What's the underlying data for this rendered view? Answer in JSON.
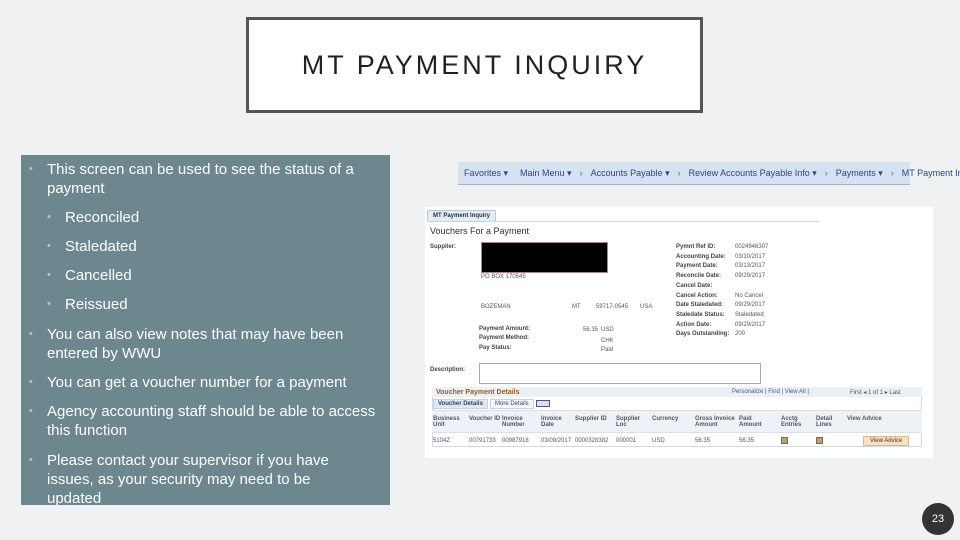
{
  "slide": {
    "title": "MT PAYMENT INQUIRY",
    "page_number": "23"
  },
  "bullets": [
    {
      "text": "This screen can be used to see the status of a payment",
      "sub": [
        "Reconciled",
        "Staledated",
        "Cancelled",
        "Reissued"
      ]
    },
    {
      "text": "You can also view notes that may have been entered by WWU"
    },
    {
      "text": "You can get a voucher number for a payment"
    },
    {
      "text": "Agency accounting staff should be able to access this function"
    },
    {
      "text": "Please contact your supervisor if you have issues, as your security may need to be updated"
    }
  ],
  "nav": {
    "items": [
      "Favorites ▾",
      "Main Menu ▾",
      "Accounts Payable ▾",
      "Review Accounts Payable Info ▾",
      "Payments ▾",
      "MT Payment Inquiry"
    ],
    "sep": "›"
  },
  "ps": {
    "tab": "MT Payment Inquiry",
    "heading": "Vouchers For a Payment",
    "supplier_label": "Supplier:",
    "address": "PO BOX 170545",
    "city": "BOZEMAN",
    "state": "MT",
    "zip": "59717-0545",
    "country": "USA",
    "payment_amount_label": "Payment Amount:",
    "payment_amount": "56.35",
    "currency": "USD",
    "payment_method_label": "Payment Method:",
    "payment_method": "CHK",
    "pay_status_label": "Pay Status:",
    "pay_status": "Paid",
    "right": [
      {
        "label": "Pymnt Ref ID:",
        "value": "0024946307"
      },
      {
        "label": "Accounting Date:",
        "value": "03/10/2017"
      },
      {
        "label": "Payment Date:",
        "value": "03/13/2017"
      },
      {
        "label": "Reconcile Date:",
        "value": "09/29/2017"
      },
      {
        "label": "Cancel Date:",
        "value": ""
      },
      {
        "label": "Cancel Action:",
        "value": "No Cancel"
      },
      {
        "label": "Date Staledated:",
        "value": "09/29/2017"
      },
      {
        "label": "Staledate Status:",
        "value": "Staledated"
      },
      {
        "label": "Action Date:",
        "value": "09/29/2017"
      },
      {
        "label": "Days Outstanding:",
        "value": "200"
      }
    ],
    "description_label": "Description:",
    "grid": {
      "title": "Voucher Payment Details",
      "tools": "Personalize | Find | View All |",
      "paging": "First ◂ 1 of 1 ▸ Last",
      "tabs": [
        "Voucher Details",
        "More Details"
      ],
      "columns": [
        "Business Unit",
        "Voucher ID",
        "Invoice Number",
        "Invoice Date",
        "Supplier ID",
        "Supplier Loc",
        "Currency",
        "Gross Invoice Amount",
        "Paid Amount",
        "Acctg Entries",
        "Detail Lines",
        "View Advice"
      ],
      "row": [
        "5104Z",
        "00791733",
        "00987918",
        "03/09/2017",
        "0000328382",
        "000001",
        "USD",
        "56.35",
        "56.35"
      ],
      "button": "View Advice"
    }
  }
}
